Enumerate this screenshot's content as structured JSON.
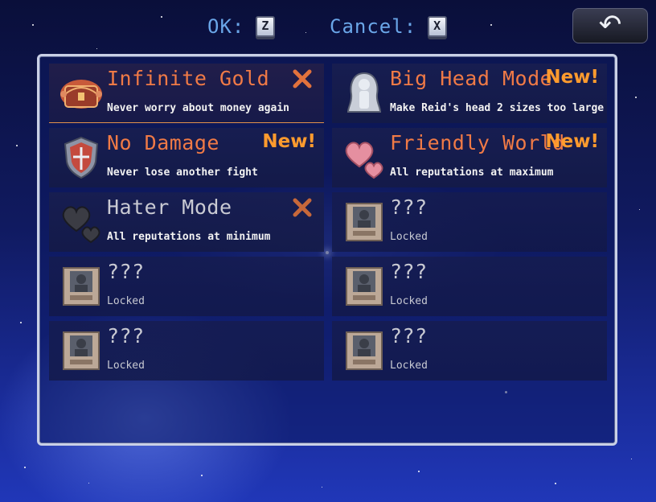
{
  "controls": {
    "ok_label": "OK:",
    "ok_key": "Z",
    "cancel_label": "Cancel:",
    "cancel_key": "X",
    "back_symbol": "↶"
  },
  "cheats": [
    {
      "title": "Infinite Gold",
      "description": "Never worry about money again",
      "status": "disabled",
      "icon": "treasure-chest-icon"
    },
    {
      "title": "Big Head Mode",
      "description": "Make Reid's head 2 sizes too large",
      "status": "new",
      "icon": "statue-icon"
    },
    {
      "title": "No Damage",
      "description": "Never lose another fight",
      "status": "new",
      "icon": "shield-icon"
    },
    {
      "title": "Friendly World",
      "description": "All reputations at maximum",
      "status": "new",
      "icon": "hearts-icon"
    },
    {
      "title": "Hater Mode",
      "description": "All reputations at minimum",
      "status": "disabled",
      "icon": "dark-hearts-icon"
    },
    {
      "title": "???",
      "description": "Locked",
      "status": "locked",
      "icon": "locked-portrait-icon"
    },
    {
      "title": "???",
      "description": "Locked",
      "status": "locked",
      "icon": "locked-portrait-icon"
    },
    {
      "title": "???",
      "description": "Locked",
      "status": "locked",
      "icon": "locked-portrait-icon"
    },
    {
      "title": "???",
      "description": "Locked",
      "status": "locked",
      "icon": "locked-portrait-icon"
    },
    {
      "title": "???",
      "description": "Locked",
      "status": "locked",
      "icon": "locked-portrait-icon"
    }
  ],
  "badges": {
    "new": "New!"
  },
  "colors": {
    "title_active": "#f07a46",
    "title_locked": "#c9cad3",
    "badge_new": "#ff9b2e",
    "hint_text": "#6aa6e8"
  }
}
